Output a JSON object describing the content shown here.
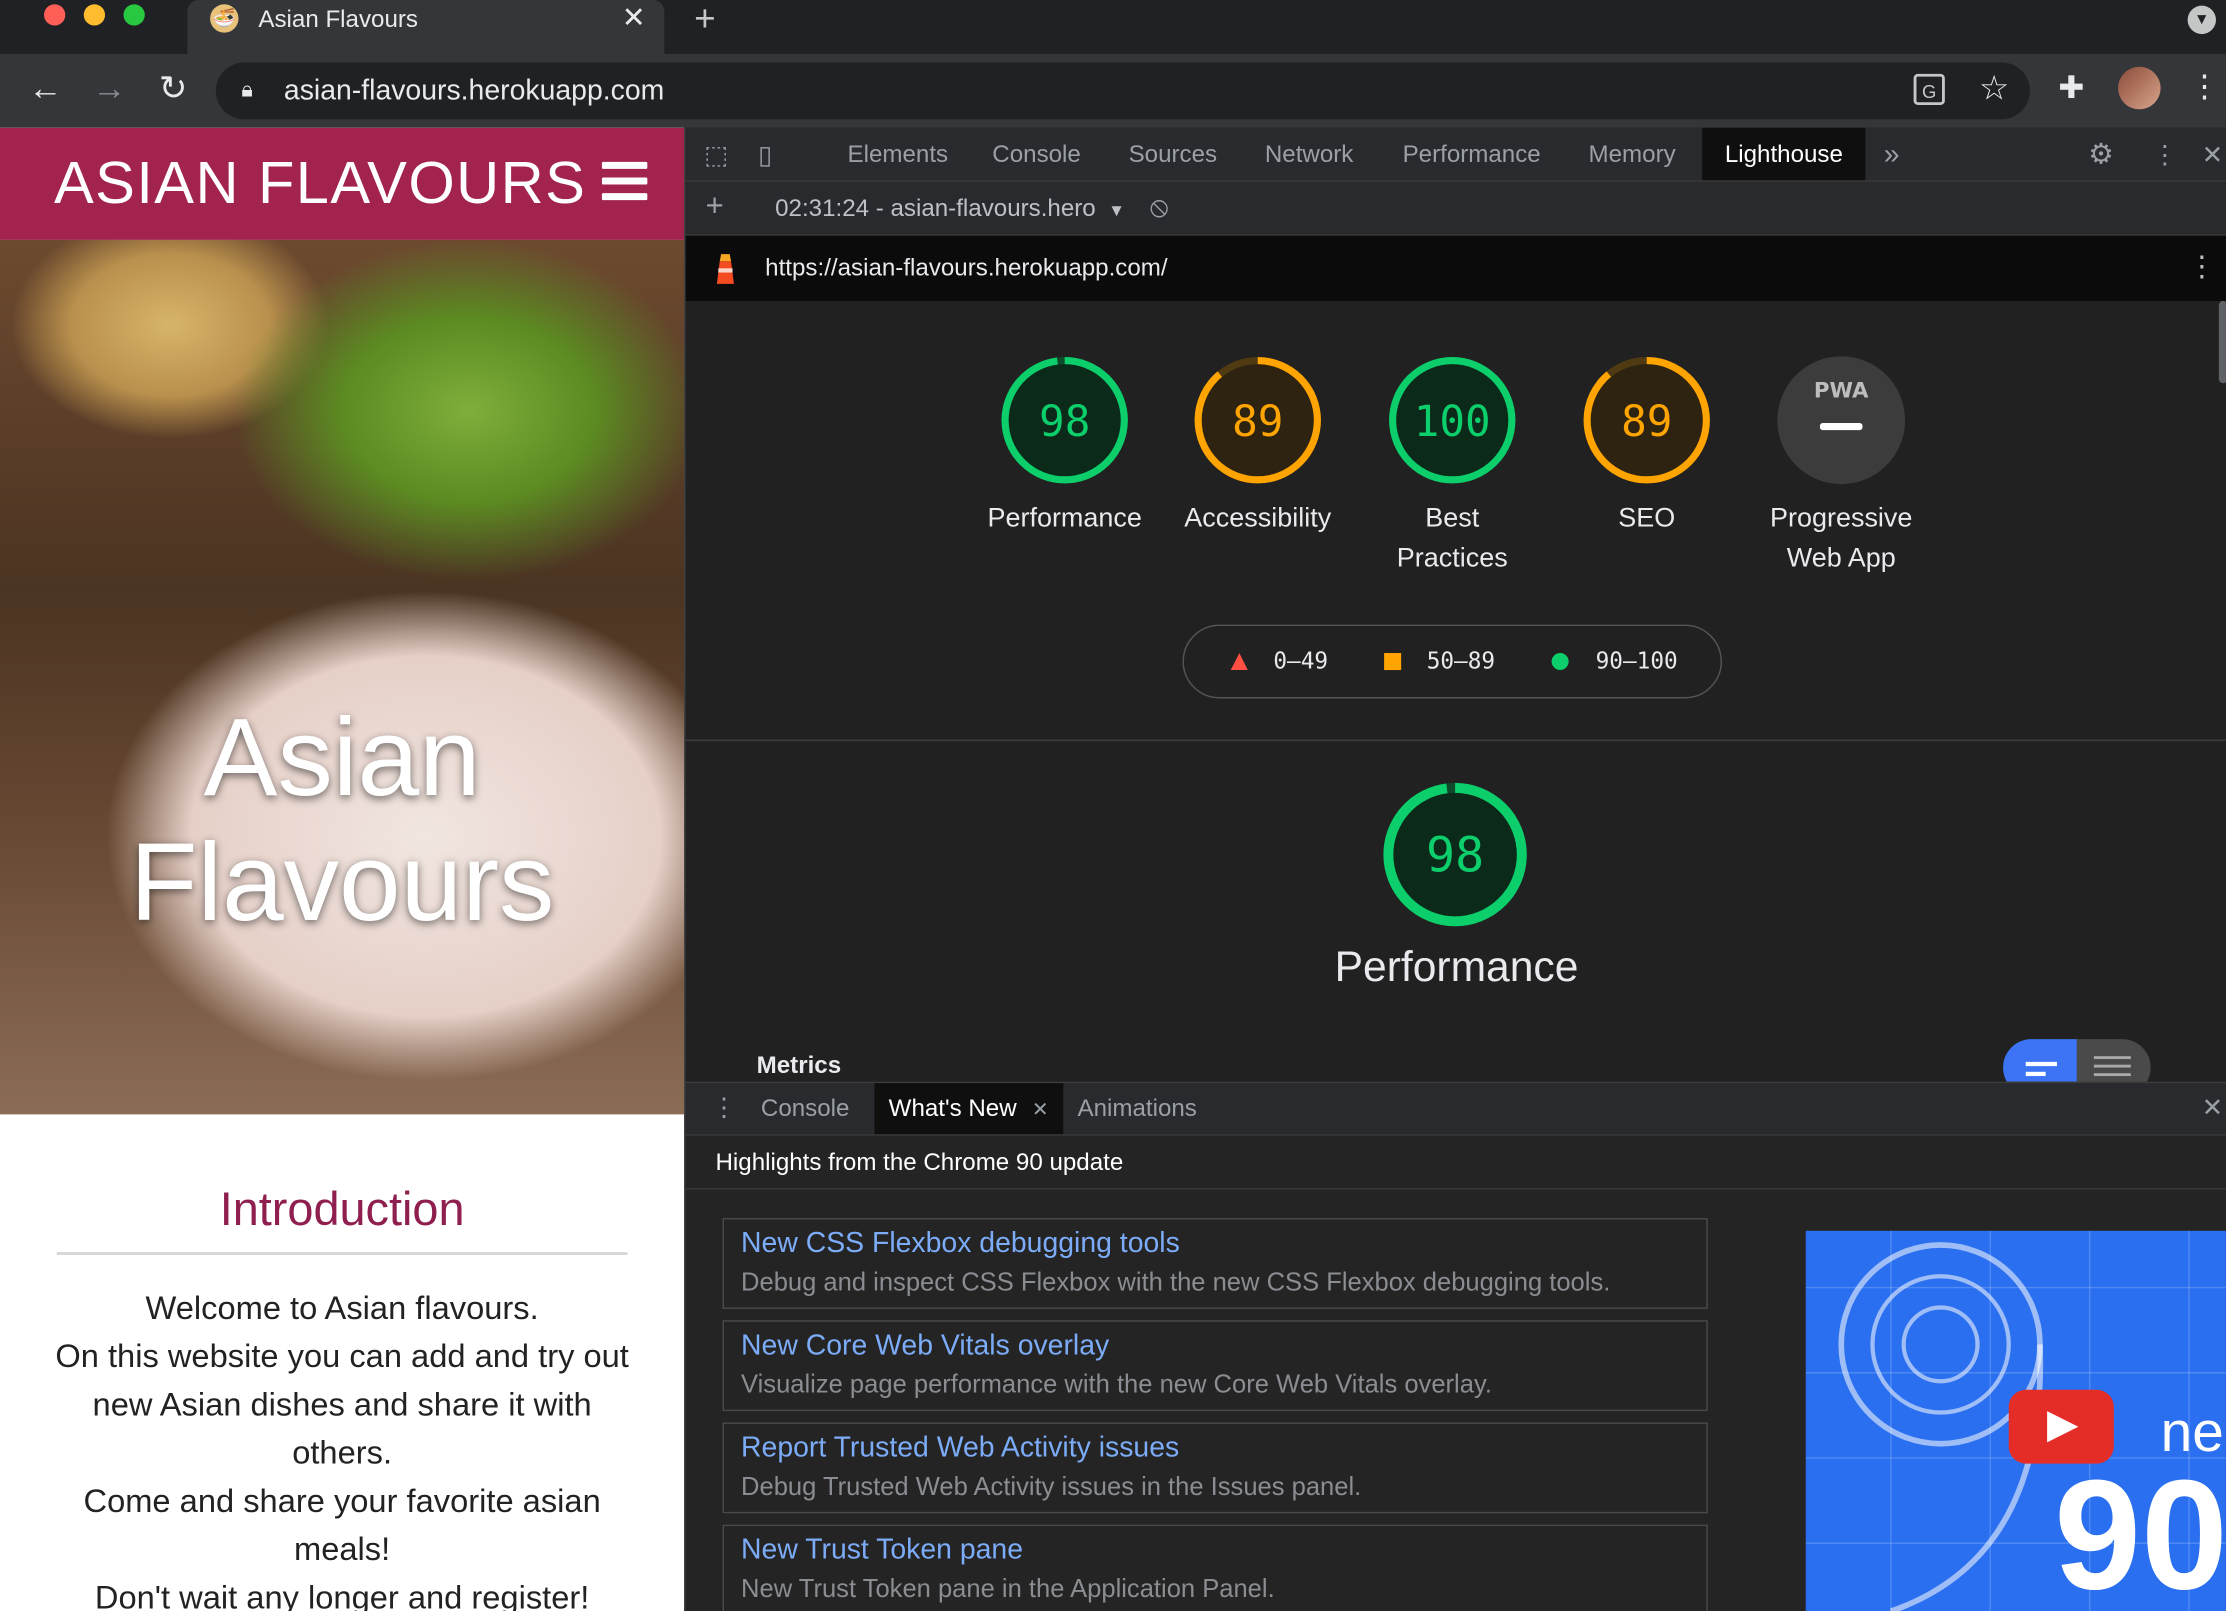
{
  "browser": {
    "tab_title": "Asian Flavours",
    "url": "asian-flavours.herokuapp.com"
  },
  "site": {
    "logo": "ASIAN FLAVOURS",
    "hero_title_line1": "Asian",
    "hero_title_line2": "Flavours",
    "intro_heading": "Introduction",
    "intro_lines": [
      "Welcome to Asian flavours.",
      "On this website you can add and try out new Asian dishes and share it with others.",
      "Come and share your favorite asian meals!",
      "Don't wait any longer and register!"
    ]
  },
  "devtools": {
    "tabs": [
      "Elements",
      "Console",
      "Sources",
      "Network",
      "Performance",
      "Memory",
      "Lighthouse"
    ],
    "active_tab": "Lighthouse",
    "report_select": "02:31:24 - asian-flavours.hero",
    "lighthouse_url": "https://asian-flavours.herokuapp.com/",
    "scores": [
      {
        "label_line1": "Performance",
        "label_line2": "",
        "score": 98,
        "color": "#0cce6b"
      },
      {
        "label_line1": "Accessibility",
        "label_line2": "",
        "score": 89,
        "color": "#ffa400"
      },
      {
        "label_line1": "Best",
        "label_line2": "Practices",
        "score": 100,
        "color": "#0cce6b"
      },
      {
        "label_line1": "SEO",
        "label_line2": "",
        "score": 89,
        "color": "#ffa400"
      },
      {
        "label_line1": "Progressive",
        "label_line2": "Web App",
        "badge": "PWA"
      }
    ],
    "legend": [
      {
        "range": "0–49",
        "shape": "triangle",
        "color": "#ff4e42"
      },
      {
        "range": "50–89",
        "shape": "square",
        "color": "#ffa400"
      },
      {
        "range": "90–100",
        "shape": "circle",
        "color": "#0cce6b"
      }
    ],
    "category_score": 98,
    "category_title": "Performance",
    "metrics_label": "Metrics",
    "drawer_tabs": [
      "Console",
      "What's New",
      "Animations"
    ],
    "drawer_active": "What's New",
    "whatsnew_header": "Highlights from the Chrome 90 update",
    "whatsnew_items": [
      {
        "title": "New CSS Flexbox debugging tools",
        "desc": "Debug and inspect CSS Flexbox with the new CSS Flexbox debugging tools."
      },
      {
        "title": "New Core Web Vitals overlay",
        "desc": "Visualize page performance with the new Core Web Vitals overlay."
      },
      {
        "title": "Report Trusted Web Activity issues",
        "desc": "Debug Trusted Web Activity issues in the Issues panel."
      },
      {
        "title": "New Trust Token pane",
        "desc": "New Trust Token pane in the Application Panel."
      }
    ],
    "video_text_new": "ne",
    "video_text_version": "90"
  },
  "colors": {
    "site_brand": "#a3234f",
    "intro_heading": "#8e1f4f",
    "lighthouse_green": "#0cce6b",
    "lighthouse_orange": "#ffa400",
    "lighthouse_red": "#ff4e42",
    "link_blue": "#7cacf8"
  }
}
